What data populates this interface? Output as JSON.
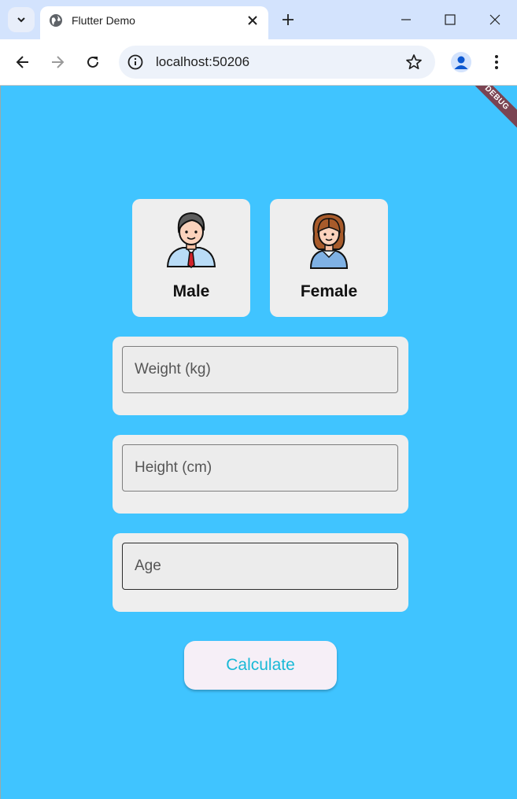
{
  "browser": {
    "tab_title": "Flutter Demo",
    "url": "localhost:50206"
  },
  "app": {
    "debug_label": "DEBUG",
    "genders": [
      {
        "label": "Male"
      },
      {
        "label": "Female"
      }
    ],
    "fields": {
      "weight_placeholder": "Weight (kg)",
      "height_placeholder": "Height (cm)",
      "age_placeholder": "Age"
    },
    "calculate_label": "Calculate"
  },
  "colors": {
    "background": "#40c4ff",
    "card": "#eeeeee",
    "button_text": "#19b9d6"
  }
}
